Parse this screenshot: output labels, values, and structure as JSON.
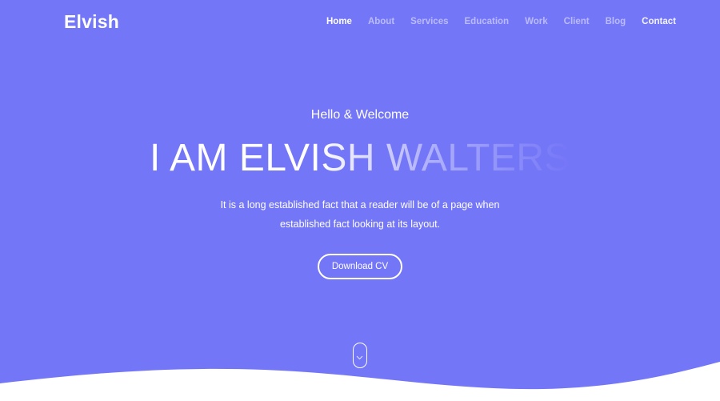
{
  "brand": {
    "logo": "Elvish"
  },
  "nav": {
    "items": [
      {
        "label": "Home",
        "active": true
      },
      {
        "label": "About"
      },
      {
        "label": "Services"
      },
      {
        "label": "Education"
      },
      {
        "label": "Work"
      },
      {
        "label": "Client"
      },
      {
        "label": "Blog"
      },
      {
        "label": "Contact"
      }
    ]
  },
  "hero": {
    "greeting": "Hello & Welcome",
    "title": "I AM ELVISH WALTERS",
    "line1": "It is a long established fact that a reader will be of a page when",
    "line2": "established fact looking at its layout.",
    "cta": "Download CV",
    "scroll_icon": "chevron-down-icon"
  },
  "colors": {
    "background": "#7476f8",
    "text": "#ffffff"
  }
}
